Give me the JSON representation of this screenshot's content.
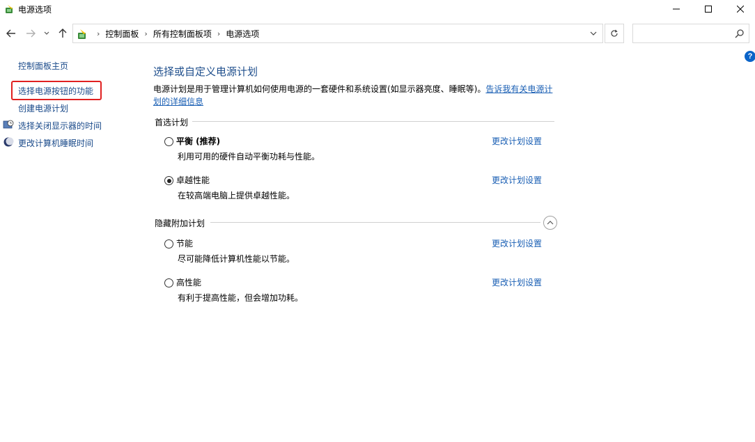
{
  "window": {
    "title": "电源选项"
  },
  "address": {
    "crumbs": [
      "控制面板",
      "所有控制面板项",
      "电源选项"
    ],
    "search_placeholder": ""
  },
  "sidebar": {
    "home": "控制面板主页",
    "items": [
      {
        "label": "选择电源按钮的功能"
      },
      {
        "label": "创建电源计划"
      },
      {
        "label": "选择关闭显示器的时间"
      },
      {
        "label": "更改计算机睡眠时间"
      }
    ]
  },
  "main": {
    "title": "选择或自定义电源计划",
    "description": "电源计划是用于管理计算机如何使用电源的一套硬件和系统设置(如显示器亮度、睡眠等)。",
    "description_link_1": "告诉我有关电源计",
    "description_link_2": "划的详细信息",
    "preferred_heading": "首选计划",
    "hidden_heading": "隐藏附加计划",
    "change_settings_label": "更改计划设置",
    "plans": [
      {
        "name": "平衡 (推荐)",
        "desc": "利用可用的硬件自动平衡功耗与性能。",
        "selected": false
      },
      {
        "name": "卓越性能",
        "desc": "在较高端电脑上提供卓越性能。",
        "selected": true
      },
      {
        "name": "节能",
        "desc": "尽可能降低计算机性能以节能。",
        "selected": false
      },
      {
        "name": "高性能",
        "desc": "有利于提高性能，但会增加功耗。",
        "selected": false
      }
    ]
  },
  "colors": {
    "link": "#1a5fb4",
    "title": "#1e4e8c",
    "highlight": "#e02020"
  }
}
